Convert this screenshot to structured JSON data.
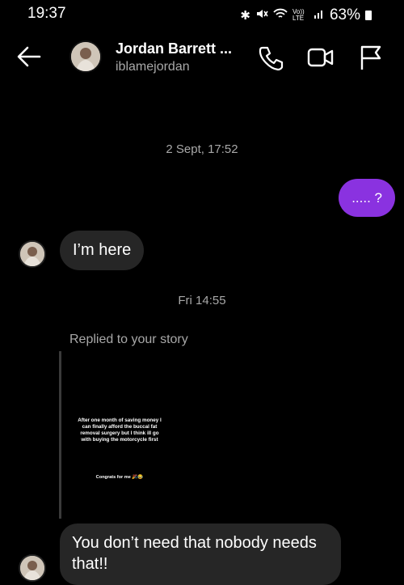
{
  "status_bar": {
    "time": "19:37",
    "network_label": "Vo)) LTE",
    "battery": "63%"
  },
  "header": {
    "name": "Jordan Barrett ...",
    "username": "iblamejordan",
    "icons": [
      "back-arrow-icon",
      "phone-icon",
      "video-icon",
      "flag-icon"
    ]
  },
  "messages": {
    "timestamp_1": "2 Sept, 17:52",
    "outgoing_1": "..... ?",
    "incoming_1": "I’m here",
    "timestamp_2": "Fri 14:55",
    "reply_label": "Replied to your story",
    "story_caption": "After one month of saving money I can finally afford the buccal fat removal surgery but I think ill go with buying the motorcycle first",
    "story_sub": "Congrats for me 🎉😂",
    "incoming_2": "You don’t need that nobody needs that!!"
  },
  "colors": {
    "background": "#000000",
    "outgoing_bubble": "#8a32e0",
    "incoming_bubble": "#262626",
    "secondary_text": "#a8a8a8"
  }
}
